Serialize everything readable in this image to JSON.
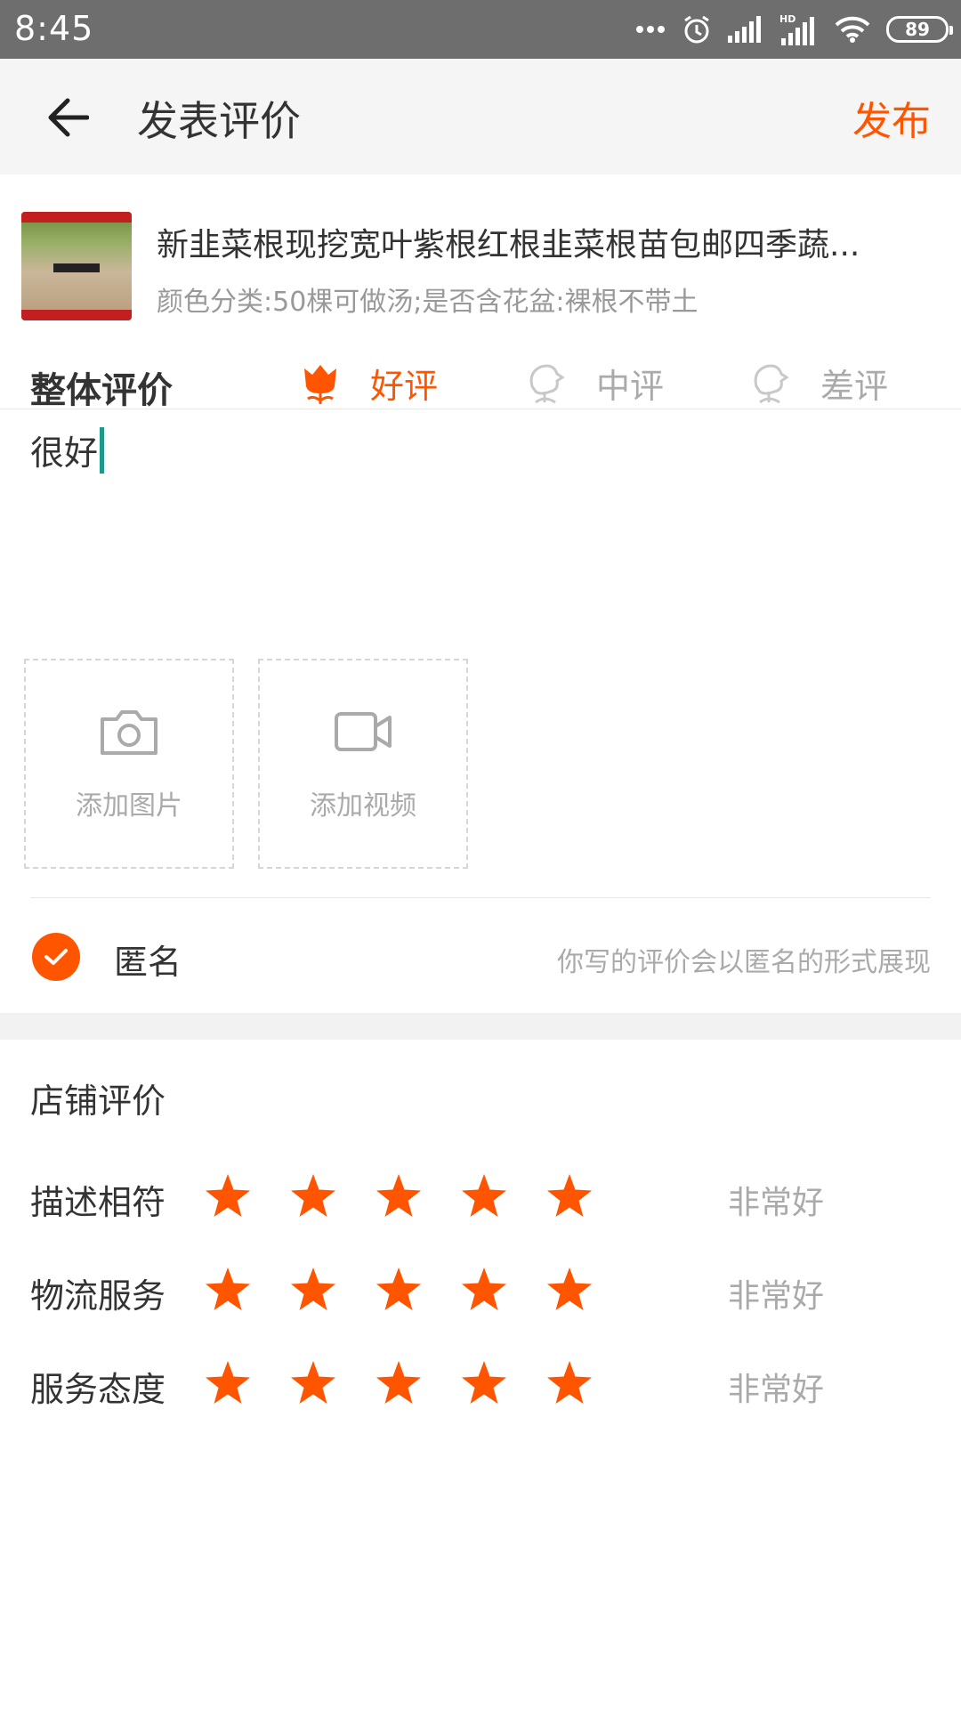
{
  "status_bar": {
    "time": "8:45",
    "battery": "89",
    "icons": [
      "more-dots-icon",
      "alarm-icon",
      "signal-icon",
      "hd-signal-icon",
      "wifi-icon",
      "battery-icon"
    ]
  },
  "header": {
    "title": "发表评价",
    "publish_label": "发布"
  },
  "product": {
    "title": "新韭菜根现挖宽叶紫根红根韭菜根苗包邮四季蔬...",
    "sku": "颜色分类:50棵可做汤;是否含花盆:裸根不带土"
  },
  "overall": {
    "label": "整体评价",
    "options": [
      {
        "label": "好评",
        "selected": true
      },
      {
        "label": "中评",
        "selected": false
      },
      {
        "label": "差评",
        "selected": false
      }
    ]
  },
  "review": {
    "text": "很好"
  },
  "media": {
    "add_photo_label": "添加图片",
    "add_video_label": "添加视频"
  },
  "anonymous": {
    "label": "匿名",
    "checked": true,
    "hint": "你写的评价会以匿名的形式展现"
  },
  "shop_rating": {
    "title": "店铺评价",
    "rows": [
      {
        "label": "描述相符",
        "stars": 5,
        "text": "非常好"
      },
      {
        "label": "物流服务",
        "stars": 5,
        "text": "非常好"
      },
      {
        "label": "服务态度",
        "stars": 5,
        "text": "非常好"
      }
    ]
  },
  "colors": {
    "accent": "#ff5500",
    "muted": "#aaaaaa",
    "status_bar": "#6e6e6e",
    "caret": "#1c9a8a"
  }
}
